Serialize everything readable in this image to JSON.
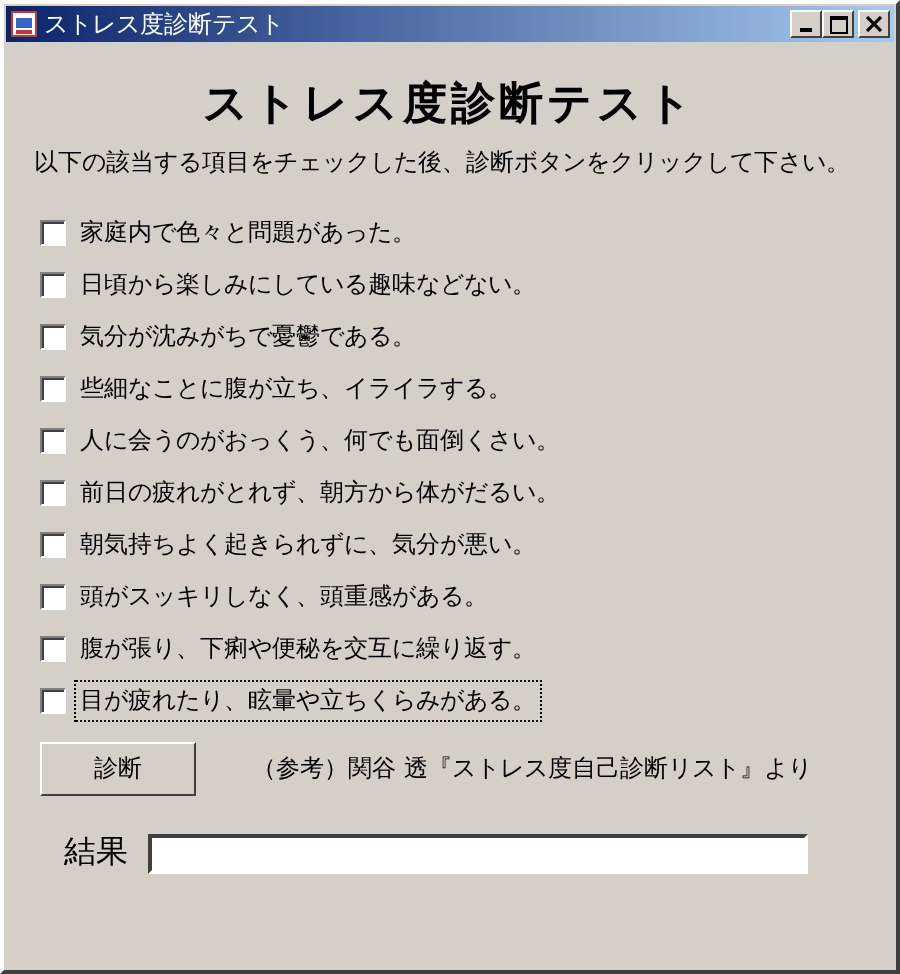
{
  "window": {
    "title": "ストレス度診断テスト"
  },
  "heading": "ストレス度診断テスト",
  "instruction": "以下の該当する項目をチェックした後、診断ボタンをクリックして下さい。",
  "items": [
    {
      "label": "家庭内で色々と問題があった。",
      "checked": false,
      "focused": false
    },
    {
      "label": "日頃から楽しみにしている趣味などない。",
      "checked": false,
      "focused": false
    },
    {
      "label": "気分が沈みがちで憂鬱である。",
      "checked": false,
      "focused": false
    },
    {
      "label": "些細なことに腹が立ち、イライラする。",
      "checked": false,
      "focused": false
    },
    {
      "label": "人に会うのがおっくう、何でも面倒くさい。",
      "checked": false,
      "focused": false
    },
    {
      "label": "前日の疲れがとれず、朝方から体がだるい。",
      "checked": false,
      "focused": false
    },
    {
      "label": "朝気持ちよく起きられずに、気分が悪い。",
      "checked": false,
      "focused": false
    },
    {
      "label": "頭がスッキリしなく、頭重感がある。",
      "checked": false,
      "focused": false
    },
    {
      "label": "腹が張り、下痢や便秘を交互に繰り返す。",
      "checked": false,
      "focused": false
    },
    {
      "label": "目が疲れたり、眩暈や立ちくらみがある。",
      "checked": false,
      "focused": true
    }
  ],
  "diagnose_button": "診断",
  "reference": "（参考）関谷 透『ストレス度自己診断リスト』より",
  "result": {
    "label": "結果"
  }
}
